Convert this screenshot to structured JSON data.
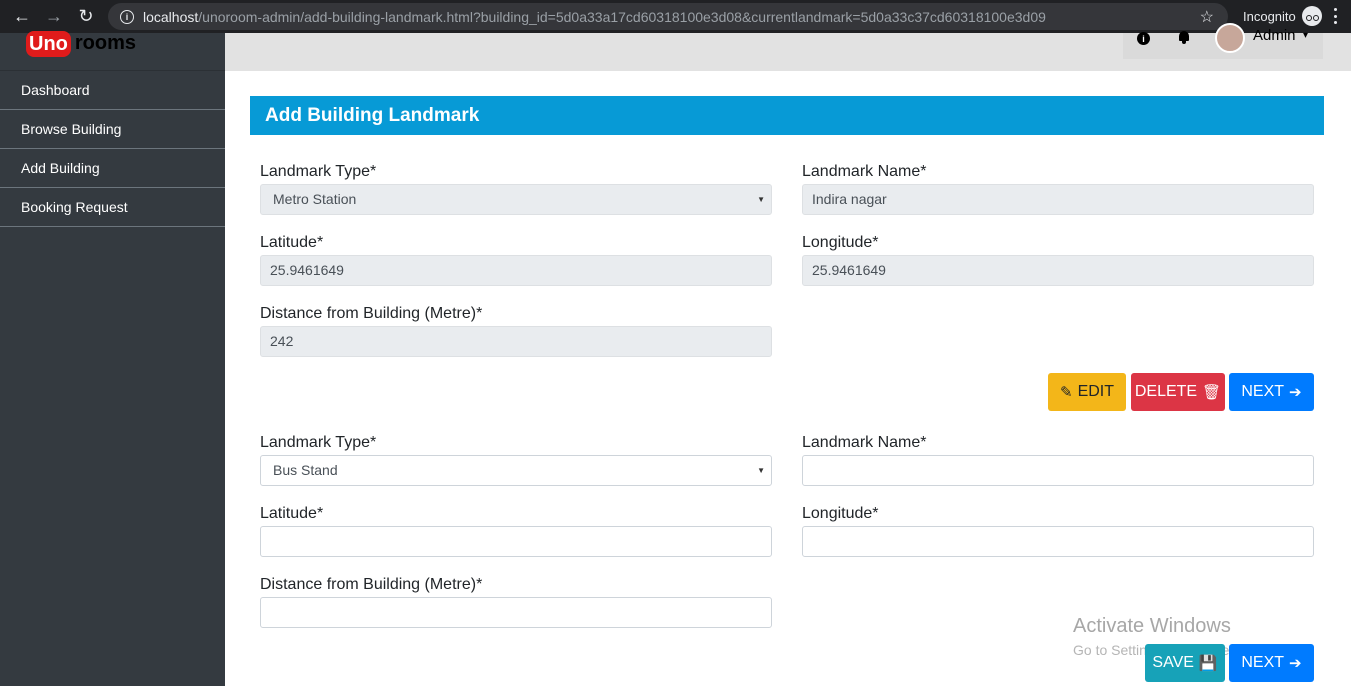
{
  "browser": {
    "url_host": "localhost",
    "url_path": "/unoroom-admin/add-building-landmark.html?building_id=5d0a33a17cd60318100e3d08&currentlandmark=5d0a33c37cd60318100e3d09",
    "incognito_label": "Incognito"
  },
  "brand": {
    "part1": "Uno",
    "part2": "rooms"
  },
  "sidebar": {
    "items": [
      {
        "label": "Dashboard"
      },
      {
        "label": "Browse Building"
      },
      {
        "label": "Add Building"
      },
      {
        "label": "Booking Request"
      }
    ]
  },
  "topbar": {
    "user": "Admin"
  },
  "page": {
    "title": "Add Building Landmark"
  },
  "landmark1": {
    "type_label": "Landmark Type*",
    "type_value": "Metro Station",
    "name_label": "Landmark Name*",
    "name_value": "Indira nagar",
    "lat_label": "Latitude*",
    "lat_value": "25.9461649",
    "lng_label": "Longitude*",
    "lng_value": "25.9461649",
    "dist_label": "Distance from Building (Metre)*",
    "dist_value": "242",
    "edit_label": "EDIT",
    "delete_label": "DELETE",
    "next_label": "NEXT"
  },
  "landmark2": {
    "type_label": "Landmark Type*",
    "type_value": "Bus Stand",
    "name_label": "Landmark Name*",
    "name_value": "",
    "lat_label": "Latitude*",
    "lat_value": "",
    "lng_label": "Longitude*",
    "lng_value": "",
    "dist_label": "Distance from Building (Metre)*",
    "dist_value": "",
    "save_label": "SAVE",
    "next_label": "NEXT"
  },
  "watermark": {
    "line1": "Activate Windows",
    "line2": "Go to Settings to activate Windows."
  }
}
